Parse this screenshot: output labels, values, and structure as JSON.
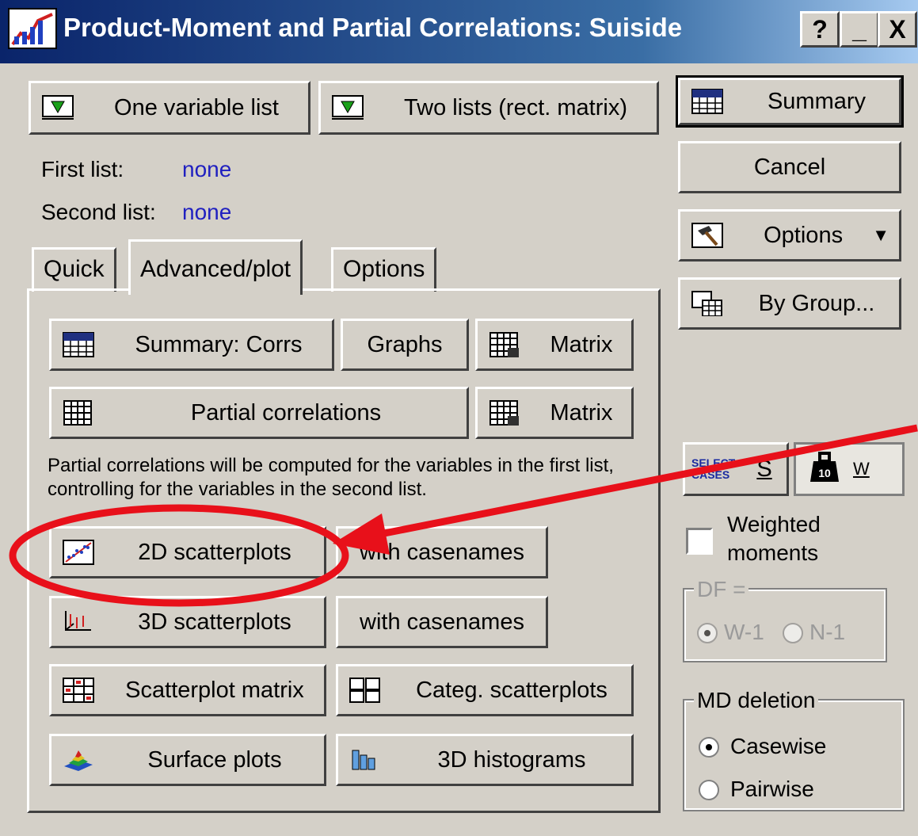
{
  "window": {
    "title": "Product-Moment and Partial Correlations: Suiside",
    "help_btn": "?",
    "min_btn": "_",
    "close_btn": "X"
  },
  "top_buttons": {
    "one_list": "One variable list",
    "two_lists": "Two lists (rect. matrix)"
  },
  "lists": {
    "first_label": "First list:",
    "first_value": "none",
    "second_label": "Second list:",
    "second_value": "none"
  },
  "tabs": [
    {
      "label": "Quick"
    },
    {
      "label": "Advanced/plot"
    },
    {
      "label": "Options"
    }
  ],
  "panel": {
    "summary_corrs": "Summary:  Corrs",
    "graphs": "Graphs",
    "matrix1": "Matrix",
    "partial": "Partial correlations",
    "matrix2": "Matrix",
    "note": "Partial correlations will be computed for the variables in the first list, controlling for the variables in the second list.",
    "scatter2d": "2D scatterplots",
    "with_casenames1": "with casenames",
    "scatter3d": "3D scatterplots",
    "with_casenames2": "with casenames",
    "scatter_matrix": "Scatterplot matrix",
    "categ_scatter": "Categ. scatterplots",
    "surface": "Surface plots",
    "hist3d": "3D histograms"
  },
  "right": {
    "summary": "Summary",
    "cancel": "Cancel",
    "options": "Options",
    "by_group": "By Group...",
    "select_cases_icon": "SELECT CASES",
    "select_cases_s": "S",
    "weight_w": "W",
    "weighted_label_1": "Weighted",
    "weighted_label_2": "moments",
    "df_legend": "DF =",
    "df_w1": "W-1",
    "df_n1": "N-1",
    "md_legend": "MD deletion",
    "md_casewise": "Casewise",
    "md_pairwise": "Pairwise"
  },
  "colors": {
    "annotation": "#e8101a",
    "link_blue": "#2020c0"
  }
}
